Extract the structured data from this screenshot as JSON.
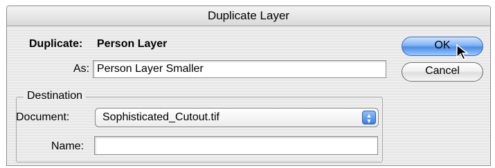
{
  "dialog": {
    "title": "Duplicate Layer"
  },
  "duplicate": {
    "label": "Duplicate:",
    "value": "Person Layer"
  },
  "as": {
    "label": "As:",
    "value": "Person Layer Smaller"
  },
  "buttons": {
    "ok": "OK",
    "cancel": "Cancel"
  },
  "destination": {
    "legend": "Destination",
    "document_label": "Document:",
    "document_value": "Sophisticated_Cutout.tif",
    "name_label": "Name:",
    "name_value": ""
  },
  "icons": {
    "popup_arrows": "updown-arrows-icon",
    "pointer": "mouse-pointer-icon"
  },
  "colors": {
    "default_button": "#4c8de6",
    "dialog_bg": "#ececec"
  }
}
